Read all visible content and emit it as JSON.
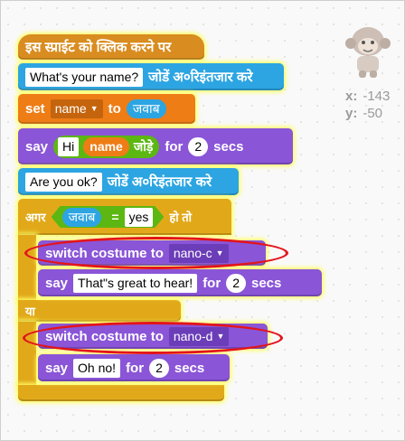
{
  "scripts": {
    "hat_label": "इस स्प्राईट को क्लिक करने पर",
    "ask1": {
      "question": "What's your name?",
      "suffix": "जोडें अ०रिइंतजार करे"
    },
    "set_block": {
      "keyword": "set",
      "variable": "name",
      "to_label": "to",
      "value": "जवाब"
    },
    "say1": {
      "keyword": "say",
      "text1": "Hi",
      "reporter": "name",
      "join_label": "जोड़े",
      "for_label": "for",
      "seconds": "2",
      "secs_label": "secs"
    },
    "ask2": {
      "question": "Are you ok?",
      "suffix": "जोडें अ०रिइंतजार करे"
    },
    "if_block": {
      "if_label": "अगर",
      "reporter": "जवाब",
      "operator": "=",
      "compare_value": "yes",
      "then_label": "हो तो",
      "else_label": "या"
    },
    "switch1": {
      "label": "switch costume to",
      "costume": "nano-c"
    },
    "say2": {
      "keyword": "say",
      "text": "That\"s great to hear!",
      "for_label": "for",
      "seconds": "2",
      "secs_label": "secs"
    },
    "switch2": {
      "label": "switch costume to",
      "costume": "nano-d"
    },
    "say3": {
      "keyword": "say",
      "text": "Oh no!",
      "for_label": "for",
      "seconds": "2",
      "secs_label": "secs"
    }
  },
  "sprite_info": {
    "x_label": "x:",
    "x_value": "-143",
    "y_label": "y:",
    "y_value": "-50"
  },
  "colors": {
    "events": "#d98c1f",
    "sensing": "#2ca5e2",
    "data": "#ee7d16",
    "looks": "#8a55d7",
    "control": "#e1a91a",
    "operators": "#5cb712",
    "highlight_glow": "#ffff66",
    "annotation_ellipse": "#e3141b"
  }
}
